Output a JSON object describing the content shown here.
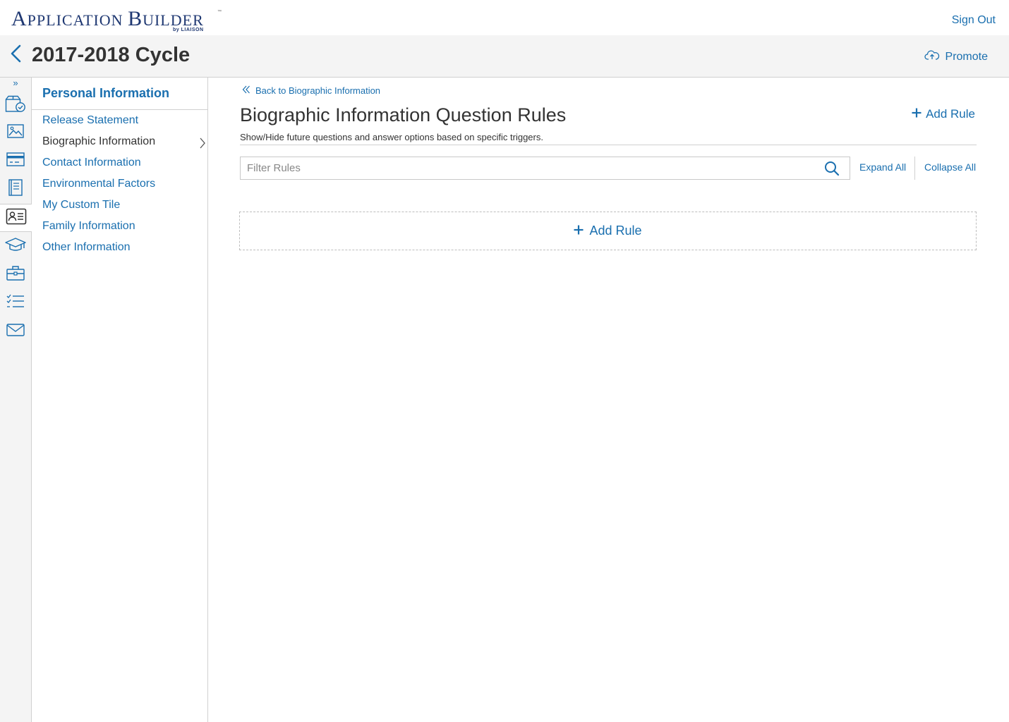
{
  "header": {
    "logo_main": "Application Builder",
    "logo_by": "by LIAISON",
    "logo_tm": "™",
    "sign_out": "Sign Out"
  },
  "cycle": {
    "title": "2017-2018 Cycle",
    "promote_label": "Promote"
  },
  "rail": {
    "expand_glyph": "»",
    "items": [
      {
        "icon": "program-check-icon"
      },
      {
        "icon": "image-icon"
      },
      {
        "icon": "payment-card-icon"
      },
      {
        "icon": "book-icon"
      },
      {
        "icon": "id-card-icon",
        "active": true
      },
      {
        "icon": "graduation-cap-icon"
      },
      {
        "icon": "briefcase-icon"
      },
      {
        "icon": "checklist-icon"
      },
      {
        "icon": "envelope-icon"
      }
    ]
  },
  "sidenav": {
    "title": "Personal Information",
    "items": [
      {
        "label": "Release Statement"
      },
      {
        "label": "Biographic Information",
        "current": true
      },
      {
        "label": "Contact Information"
      },
      {
        "label": "Environmental Factors"
      },
      {
        "label": "My Custom Tile"
      },
      {
        "label": "Family Information"
      },
      {
        "label": "Other Information"
      }
    ]
  },
  "main": {
    "back_link": "Back to Biographic Information",
    "title": "Biographic Information Question Rules",
    "description": "Show/Hide future questions and answer options based on specific triggers.",
    "add_rule_label": "Add Rule",
    "filter_placeholder": "Filter Rules",
    "filter_value": "",
    "expand_all": "Expand All",
    "collapse_all": "Collapse All",
    "add_rule_box_label": "Add Rule"
  },
  "colors": {
    "accent": "#1a6faf",
    "brand": "#1f3872",
    "text": "#333333",
    "panel_bg": "#f4f4f4",
    "border": "#d0d0d0"
  }
}
